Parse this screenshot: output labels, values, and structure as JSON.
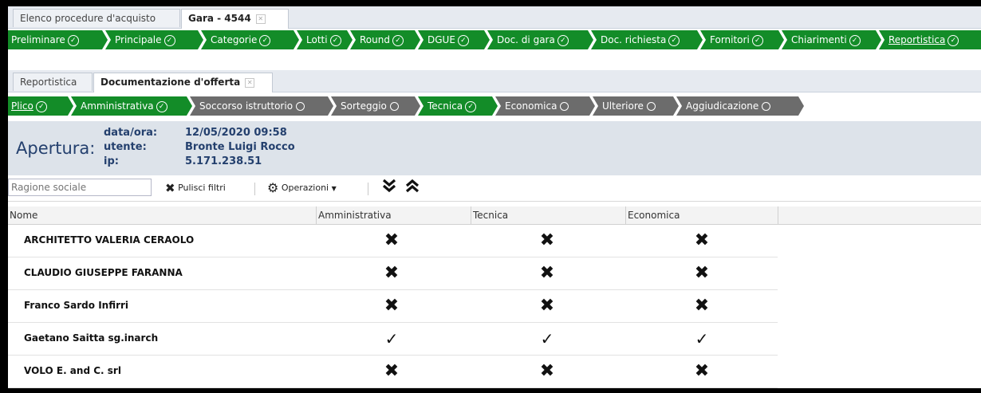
{
  "top_tabs": [
    {
      "label": "Elenco procedure d'acquisto"
    },
    {
      "label": "Gara - 4544"
    }
  ],
  "steps_main": [
    {
      "label": "Preliminare",
      "status": "done"
    },
    {
      "label": "Principale",
      "status": "done"
    },
    {
      "label": "Categorie",
      "status": "done"
    },
    {
      "label": "Lotti",
      "status": "done"
    },
    {
      "label": "Round",
      "status": "done"
    },
    {
      "label": "DGUE",
      "status": "done"
    },
    {
      "label": "Doc. di gara",
      "status": "done"
    },
    {
      "label": "Doc. richiesta",
      "status": "done"
    },
    {
      "label": "Fornitori",
      "status": "done"
    },
    {
      "label": "Chiarimenti",
      "status": "done"
    },
    {
      "label": "Reportistica",
      "status": "done"
    }
  ],
  "sub_tabs": [
    {
      "label": "Reportistica"
    },
    {
      "label": "Documentazione d'offerta"
    }
  ],
  "steps_sub": [
    {
      "label": "Plico",
      "status": "done"
    },
    {
      "label": "Amministrativa",
      "status": "done"
    },
    {
      "label": "Soccorso istruttorio",
      "status": "pending"
    },
    {
      "label": "Sorteggio",
      "status": "pending"
    },
    {
      "label": "Tecnica",
      "status": "done"
    },
    {
      "label": "Economica",
      "status": "pending"
    },
    {
      "label": "Ulteriore",
      "status": "pending"
    },
    {
      "label": "Aggiudicazione",
      "status": "pending"
    }
  ],
  "apertura": {
    "title": "Apertura:",
    "data_label": "data/ora:",
    "data_value": "12/05/2020 09:58",
    "utente_label": "utente:",
    "utente_value": "Bronte Luigi Rocco",
    "ip_label": "ip:",
    "ip_value": "5.171.238.51"
  },
  "toolbar": {
    "search_placeholder": "Ragione sociale",
    "clear_filters": "Pulisci filtri",
    "operations": "Operazioni"
  },
  "table": {
    "columns": [
      "Nome",
      "Amministrativa",
      "Tecnica",
      "Economica"
    ],
    "rows": [
      {
        "name": "ARCHITETTO VALERIA CERAOLO",
        "amministrativa": "✖",
        "tecnica": "✖",
        "economica": "✖"
      },
      {
        "name": "CLAUDIO GIUSEPPE FARANNA",
        "amministrativa": "✖",
        "tecnica": "✖",
        "economica": "✖"
      },
      {
        "name": "Franco Sardo Infirri",
        "amministrativa": "✖",
        "tecnica": "✖",
        "economica": "✖"
      },
      {
        "name": "Gaetano Saitta sg.inarch",
        "amministrativa": "✓",
        "tecnica": "✓",
        "economica": "✓"
      },
      {
        "name": "VOLO E. and C. srl",
        "amministrativa": "✖",
        "tecnica": "✖",
        "economica": "✖"
      }
    ]
  },
  "icons": {
    "check_circle": "check-circle-icon",
    "open_circle": "open-circle-icon",
    "close": "close-icon",
    "gear": "gear-icon",
    "expand_all": "double-chevron-down-icon",
    "collapse_all": "double-chevron-up-icon"
  },
  "colors": {
    "step_done": "#138c28",
    "step_pending": "#6c6c6c",
    "apertura_text": "#24406e"
  }
}
